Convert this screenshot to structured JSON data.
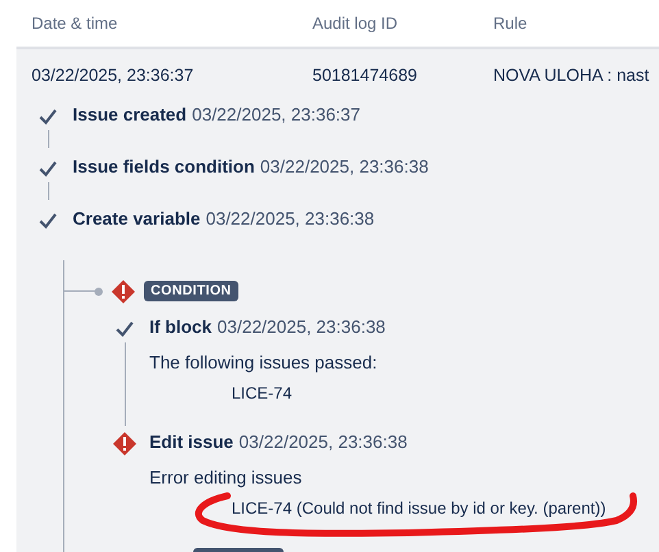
{
  "columns": [
    "Date & time",
    "Audit log ID",
    "Rule"
  ],
  "row": {
    "date": "03/22/2025, 23:36:37",
    "id": "50181474689",
    "rule": "NOVA ULOHA : nast"
  },
  "steps": [
    {
      "kind": "success",
      "title": "Issue created",
      "time": "03/22/2025, 23:36:37"
    },
    {
      "kind": "success",
      "title": "Issue fields condition",
      "time": "03/22/2025, 23:36:38"
    },
    {
      "kind": "success",
      "title": "Create variable",
      "time": "03/22/2025, 23:36:38"
    }
  ],
  "condition": {
    "kind": "error",
    "badge": "CONDITION",
    "children": [
      {
        "kind": "success",
        "title": "If block",
        "time": "03/22/2025, 23:36:38",
        "message": "The following issues passed:",
        "detail": "LICE-74"
      },
      {
        "kind": "error",
        "title": "Edit issue",
        "time": "03/22/2025, 23:36:38",
        "message": "Error editing issues",
        "detail": "LICE-74 (Could not find issue by id or key. (parent))"
      }
    ]
  }
}
